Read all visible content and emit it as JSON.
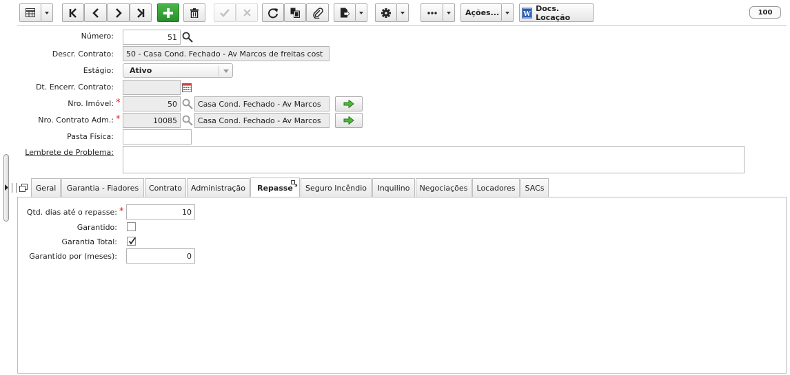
{
  "toolbar": {
    "grid_icon": "grid-view-icon",
    "first_icon": "first-record-icon",
    "prev_icon": "previous-record-icon",
    "next_icon": "next-record-icon",
    "last_icon": "last-record-icon",
    "add_icon": "add-icon",
    "delete_icon": "trash-icon",
    "confirm_icon": "check-icon",
    "cancel_icon": "close-icon",
    "refresh_icon": "refresh-icon",
    "copy_icon": "copy-icon",
    "attach_icon": "paperclip-icon",
    "export_icon": "export-icon",
    "settings_icon": "gear-icon",
    "more_icon": "more-icon",
    "acoes_label": "Ações...",
    "docs_label": "Docs. Locação",
    "page_size": "100"
  },
  "form": {
    "numero_label": "Número:",
    "numero_value": "51",
    "descr_label": "Descr. Contrato:",
    "descr_value": "50 - Casa Cond. Fechado - Av Marcos de freitas cost",
    "estagio_label": "Estágio:",
    "estagio_value": "Ativo",
    "dt_encerr_label": "Dt. Encerr. Contrato:",
    "dt_encerr_value": "",
    "nro_imovel_label": "Nro. Imóvel:",
    "nro_imovel_value": "50",
    "nro_imovel_desc": "Casa Cond. Fechado - Av Marcos",
    "nro_contrato_label": "Nro. Contrato Adm.:",
    "nro_contrato_value": "10085",
    "nro_contrato_desc": "Casa Cond. Fechado - Av Marcos",
    "pasta_label": "Pasta Física:",
    "pasta_value": "",
    "lembrete_label": "Lembrete de Problema:",
    "lembrete_value": ""
  },
  "tabs": [
    {
      "label": "Geral"
    },
    {
      "label": "Garantia - Fiadores"
    },
    {
      "label": "Contrato"
    },
    {
      "label": "Administração"
    },
    {
      "label": "Repasse"
    },
    {
      "label": "Seguro Incêndio"
    },
    {
      "label": "Inquilino"
    },
    {
      "label": "Negociações"
    },
    {
      "label": "Locadores"
    },
    {
      "label": "SACs"
    }
  ],
  "repasse": {
    "qtd_dias_label": "Qtd. dias até o repasse:",
    "qtd_dias_value": "10",
    "garantido_label": "Garantido:",
    "garantido_checked": false,
    "garantia_total_label": "Garantia Total:",
    "garantia_total_checked": true,
    "garantido_meses_label": "Garantido por (meses):",
    "garantido_meses_value": "0"
  },
  "colors": {
    "accent_green": "#2f9e2f",
    "required": "#d22222"
  }
}
